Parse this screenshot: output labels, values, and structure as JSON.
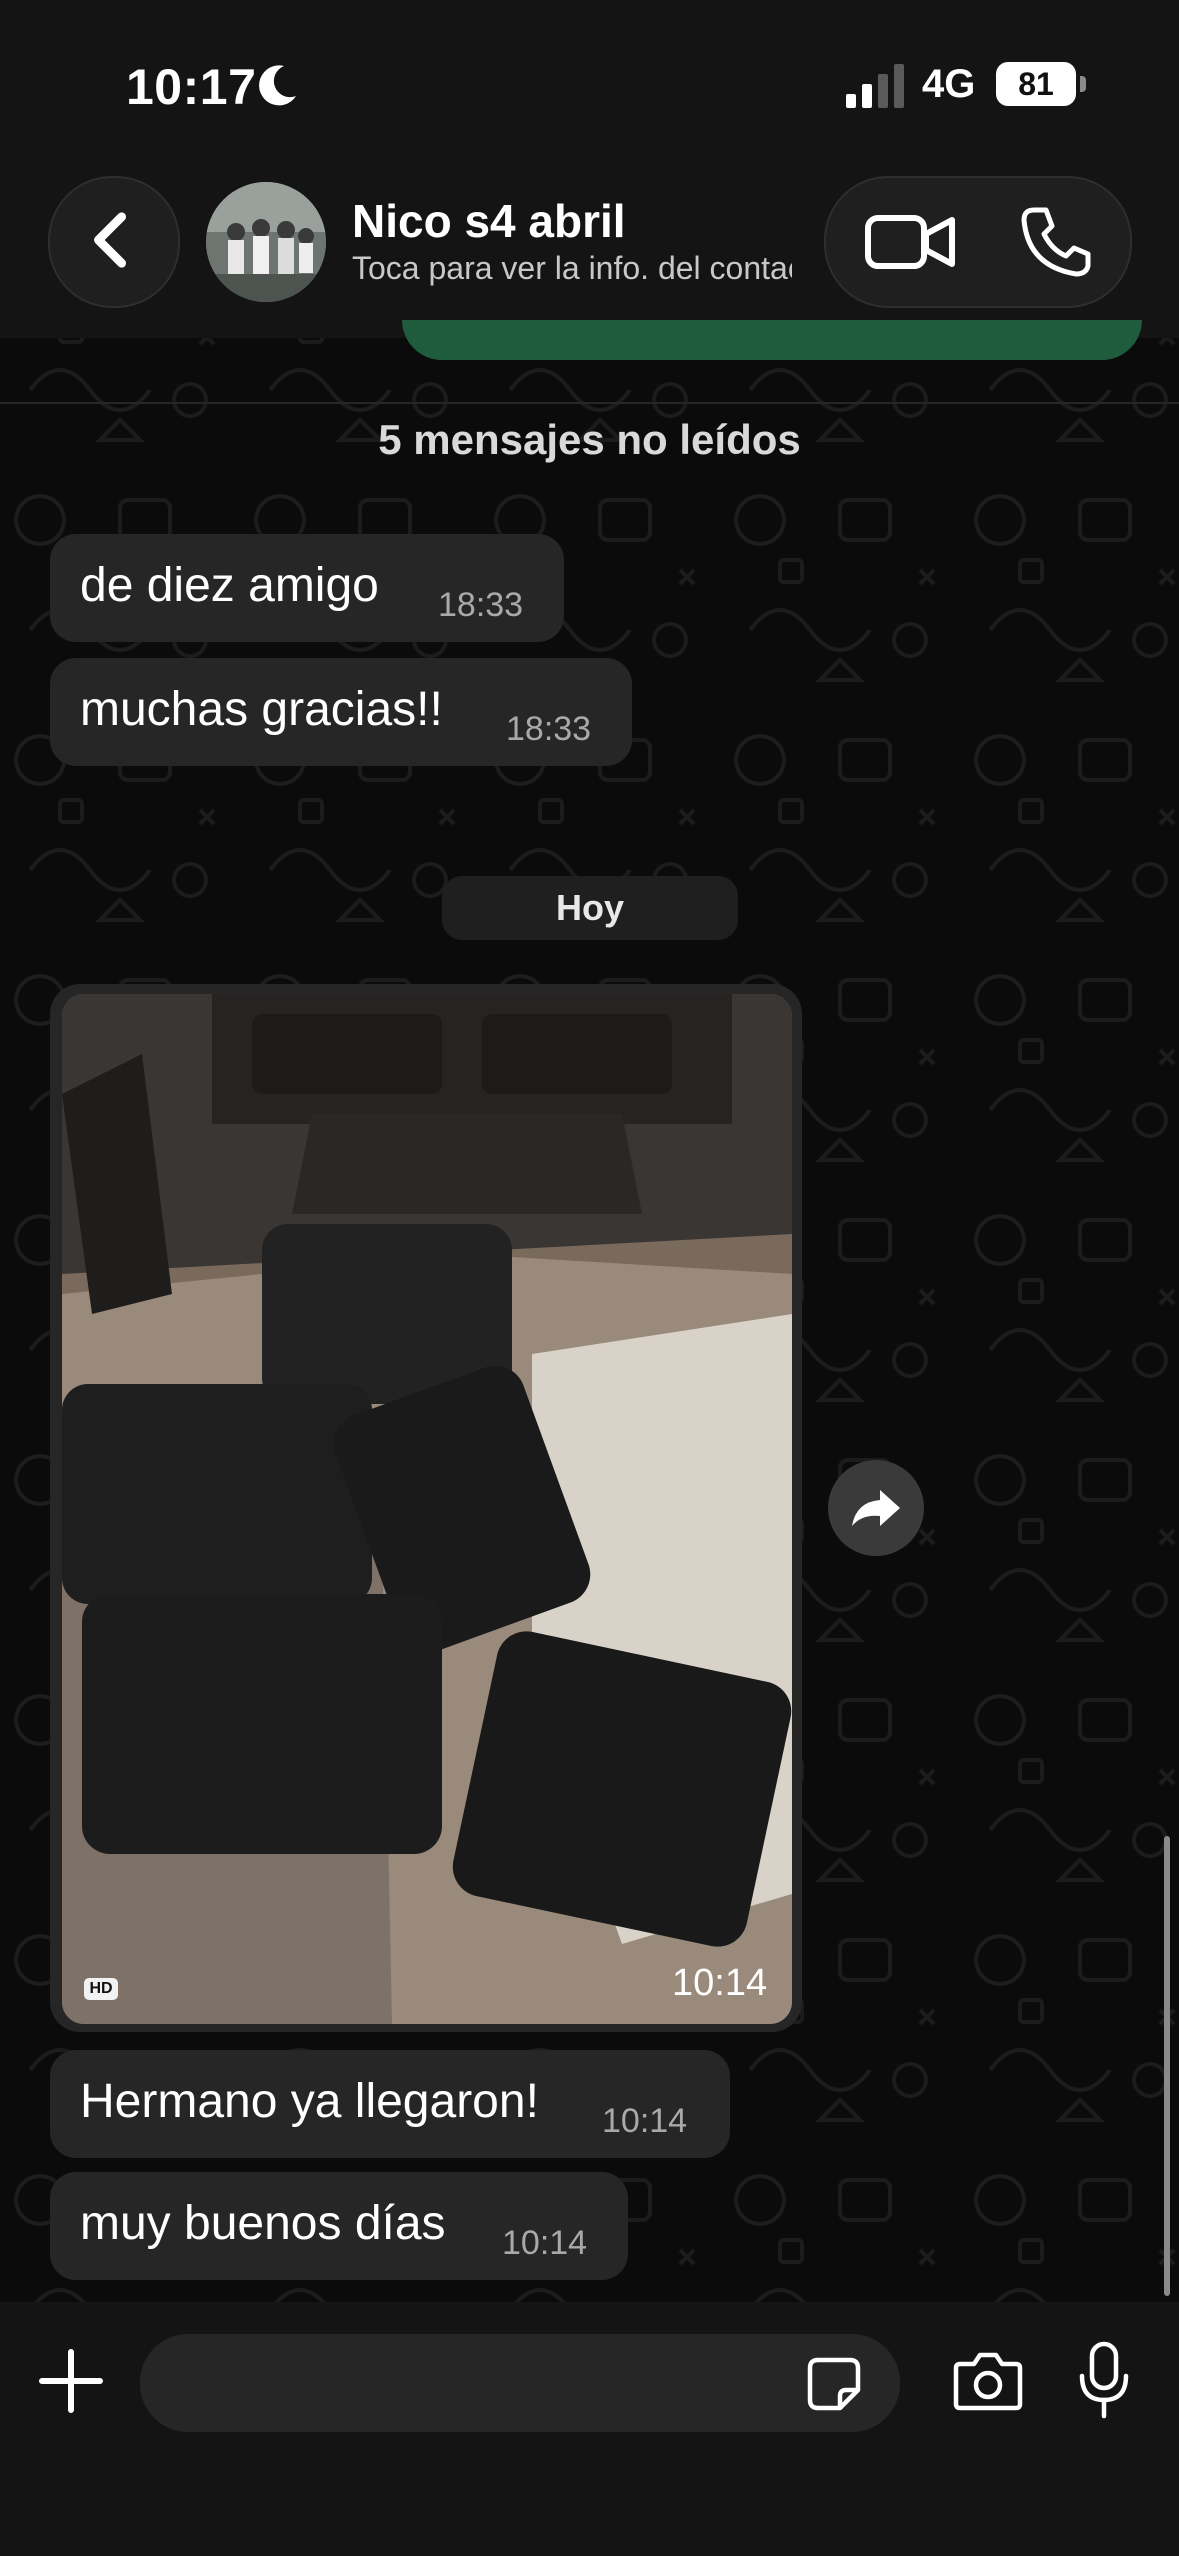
{
  "status_bar": {
    "time": "10:17",
    "network": "4G",
    "battery": "81",
    "icons": [
      "moon-icon",
      "signal-icon"
    ]
  },
  "header": {
    "back_icon": "chevron-left-icon",
    "contact_name": "Nico s4 abril",
    "contact_subtitle": "Toca para ver la info. del contacto",
    "video_icon": "video-camera-icon",
    "phone_icon": "phone-icon"
  },
  "chat": {
    "unread_label": "5 mensajes no leídos",
    "day_separator": "Hoy",
    "earlier_messages": [
      {
        "text": "de diez amigo",
        "time": "18:33"
      },
      {
        "text": "muchas gracias!!",
        "time": "18:33"
      }
    ],
    "image_message": {
      "badge": "HD",
      "time": "10:14",
      "forward_icon": "forward-icon"
    },
    "later_messages": [
      {
        "text": "Hermano ya llegaron!",
        "time": "10:14"
      },
      {
        "text": "muy buenos días",
        "time": "10:14"
      }
    ]
  },
  "composer": {
    "attach_icon": "plus-icon",
    "sticker_icon": "sticker-icon",
    "camera_icon": "camera-icon",
    "mic_icon": "microphone-icon",
    "placeholder": ""
  },
  "colors": {
    "background": "#0b0b0b",
    "bar": "#141414",
    "bubble": "#262626",
    "own_bubble": "#1f5c3e",
    "timestamp": "#a9a9a9"
  }
}
